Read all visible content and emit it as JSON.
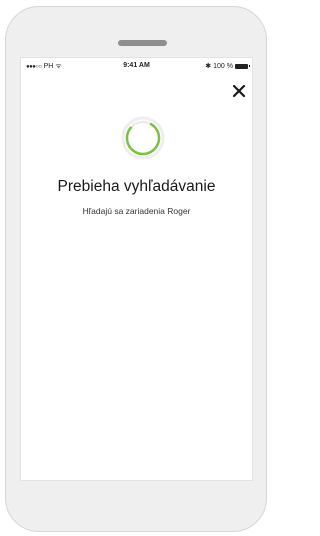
{
  "status_bar": {
    "signal": "●●●○○",
    "carrier": "PH",
    "wifi_glyph": "ᯤ",
    "time": "9:41 AM",
    "bluetooth_glyph": "✱",
    "battery": "100 %"
  },
  "close": {
    "icon": "close-icon"
  },
  "spinner": {
    "icon": "loading-spinner-icon",
    "color": "#7ac143"
  },
  "main": {
    "title": "Prebieha vyhľadávanie",
    "subtitle": "Hľadajú sa zariadenia Roger"
  }
}
